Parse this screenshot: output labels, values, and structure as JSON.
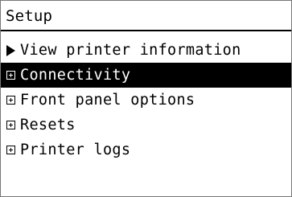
{
  "screen": {
    "title": "Setup"
  },
  "menu": {
    "items": [
      {
        "label": "View printer information",
        "icon": "right-arrow-icon",
        "selected": false
      },
      {
        "label": "Connectivity",
        "icon": "expand-box-icon",
        "selected": true
      },
      {
        "label": "Front panel options",
        "icon": "expand-box-icon",
        "selected": false
      },
      {
        "label": "Resets",
        "icon": "expand-box-icon",
        "selected": false
      },
      {
        "label": "Printer logs",
        "icon": "expand-box-icon",
        "selected": false
      }
    ]
  },
  "colors": {
    "background": "#ffffff",
    "text": "#000000",
    "selected_background": "#000000",
    "selected_text": "#ffffff"
  }
}
